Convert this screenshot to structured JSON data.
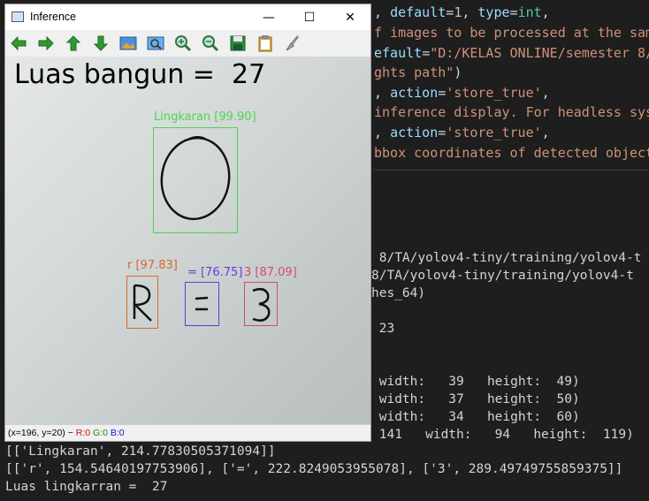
{
  "editor": {
    "lines": [
      [
        {
          "t": ", ",
          "c": "c-plain"
        },
        {
          "t": "default",
          "c": "c-def"
        },
        {
          "t": "=",
          "c": "c-plain"
        },
        {
          "t": "1",
          "c": "c-num"
        },
        {
          "t": ", ",
          "c": "c-plain"
        },
        {
          "t": "type",
          "c": "c-def"
        },
        {
          "t": "=",
          "c": "c-plain"
        },
        {
          "t": "int",
          "c": "c-type"
        },
        {
          "t": ",",
          "c": "c-plain"
        }
      ],
      [
        {
          "t": "f images to be processed at the sam",
          "c": "c-str"
        }
      ],
      [
        {
          "t": "efault",
          "c": "c-def"
        },
        {
          "t": "=",
          "c": "c-plain"
        },
        {
          "t": "\"D:/KELAS ONLINE/semester 8/",
          "c": "c-str"
        }
      ],
      [
        {
          "t": "ghts path\"",
          "c": "c-str"
        },
        {
          "t": ")",
          "c": "c-plain"
        }
      ],
      [
        {
          "t": ", ",
          "c": "c-plain"
        },
        {
          "t": "action",
          "c": "c-def"
        },
        {
          "t": "=",
          "c": "c-plain"
        },
        {
          "t": "'store_true'",
          "c": "c-str"
        },
        {
          "t": ",",
          "c": "c-plain"
        }
      ],
      [
        {
          "t": "inference display. For headless sys",
          "c": "c-str"
        }
      ],
      [
        {
          "t": ", ",
          "c": "c-plain"
        },
        {
          "t": "action",
          "c": "c-def"
        },
        {
          "t": "=",
          "c": "c-plain"
        },
        {
          "t": "'store_true'",
          "c": "c-str"
        },
        {
          "t": ",",
          "c": "c-plain"
        }
      ],
      [
        {
          "t": "bbox coordinates of detected object",
          "c": "c-str"
        }
      ]
    ]
  },
  "terminal_right": [
    " 8/TA/yolov4-tiny/training/yolov4-t",
    "8/TA/yolov4-tiny/training/yolov4-t",
    "hes_64)",
    "",
    " 23",
    "",
    "",
    " width:   39   height:  49)",
    " width:   37   height:  50)",
    " width:   34   height:  60)",
    " 141   width:   94   height:  119)"
  ],
  "terminal_bottom": [
    "[['Lingkaran', 214.77830505371094]]",
    "[['r', 154.54640197753906], ['=', 222.8249053955078], ['3', 289.49749755859375]]",
    "Luas lingkarran =  27"
  ],
  "window": {
    "title": "Inference",
    "minimize": "—",
    "maximize": "☐",
    "close": "✕",
    "overlay_text": "Luas bangun =  27",
    "status": {
      "coords": "(x=196, y=20) ~ ",
      "r": "R:0",
      "g": "G:0",
      "b": "B:0"
    },
    "detections": [
      {
        "label": "Lingkaran [99.90]",
        "color": "#4ad84a",
        "glyph": "O"
      },
      {
        "label": "r [97.83]",
        "color": "#d46a2a",
        "glyph": "R"
      },
      {
        "label": "= [76.75]",
        "color": "#6a3ad4",
        "glyph": "="
      },
      {
        "label": "3 [87.09]",
        "color": "#d44a6a",
        "glyph": "3"
      }
    ]
  },
  "toolbar": {
    "icons": [
      "arrow-left-icon",
      "arrow-right-icon",
      "arrow-up-icon",
      "arrow-down-icon",
      "image-icon",
      "zoom-window-icon",
      "zoom-in-icon",
      "zoom-out-icon",
      "save-icon",
      "clipboard-icon",
      "properties-brush-icon"
    ]
  }
}
